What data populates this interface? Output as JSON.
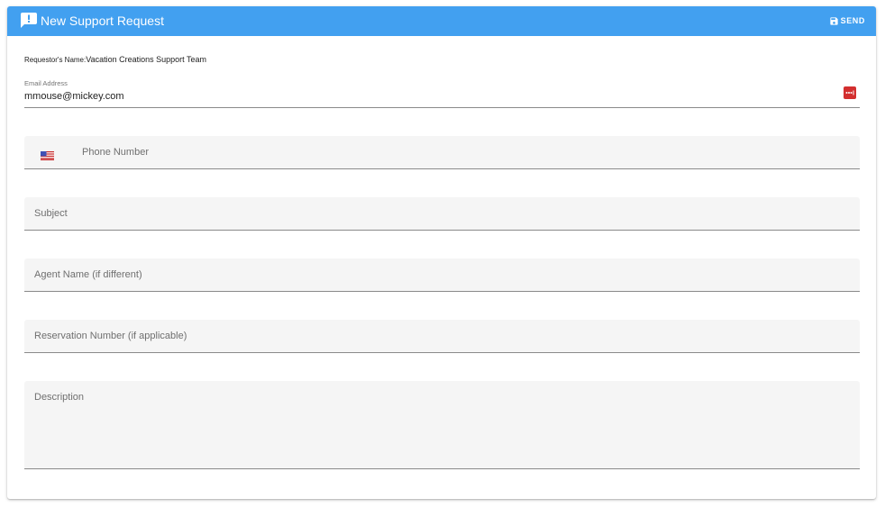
{
  "header": {
    "title": "New Support Request",
    "send_label": "SEND",
    "background_color": "#42a0f0"
  },
  "requestor": {
    "label": "Requestor's Name:",
    "value": "Vacation Creations Support Team"
  },
  "email": {
    "label": "Email Address",
    "value": "mmouse@mickey.com",
    "trailing_icon": "password-manager-icon"
  },
  "phone": {
    "placeholder": "Phone Number",
    "country_icon": "us-flag-icon"
  },
  "subject": {
    "placeholder": "Subject"
  },
  "agent_name": {
    "placeholder": "Agent Name (if different)"
  },
  "reservation_number": {
    "placeholder": "Reservation Number (if applicable)"
  },
  "description": {
    "placeholder": "Description"
  }
}
